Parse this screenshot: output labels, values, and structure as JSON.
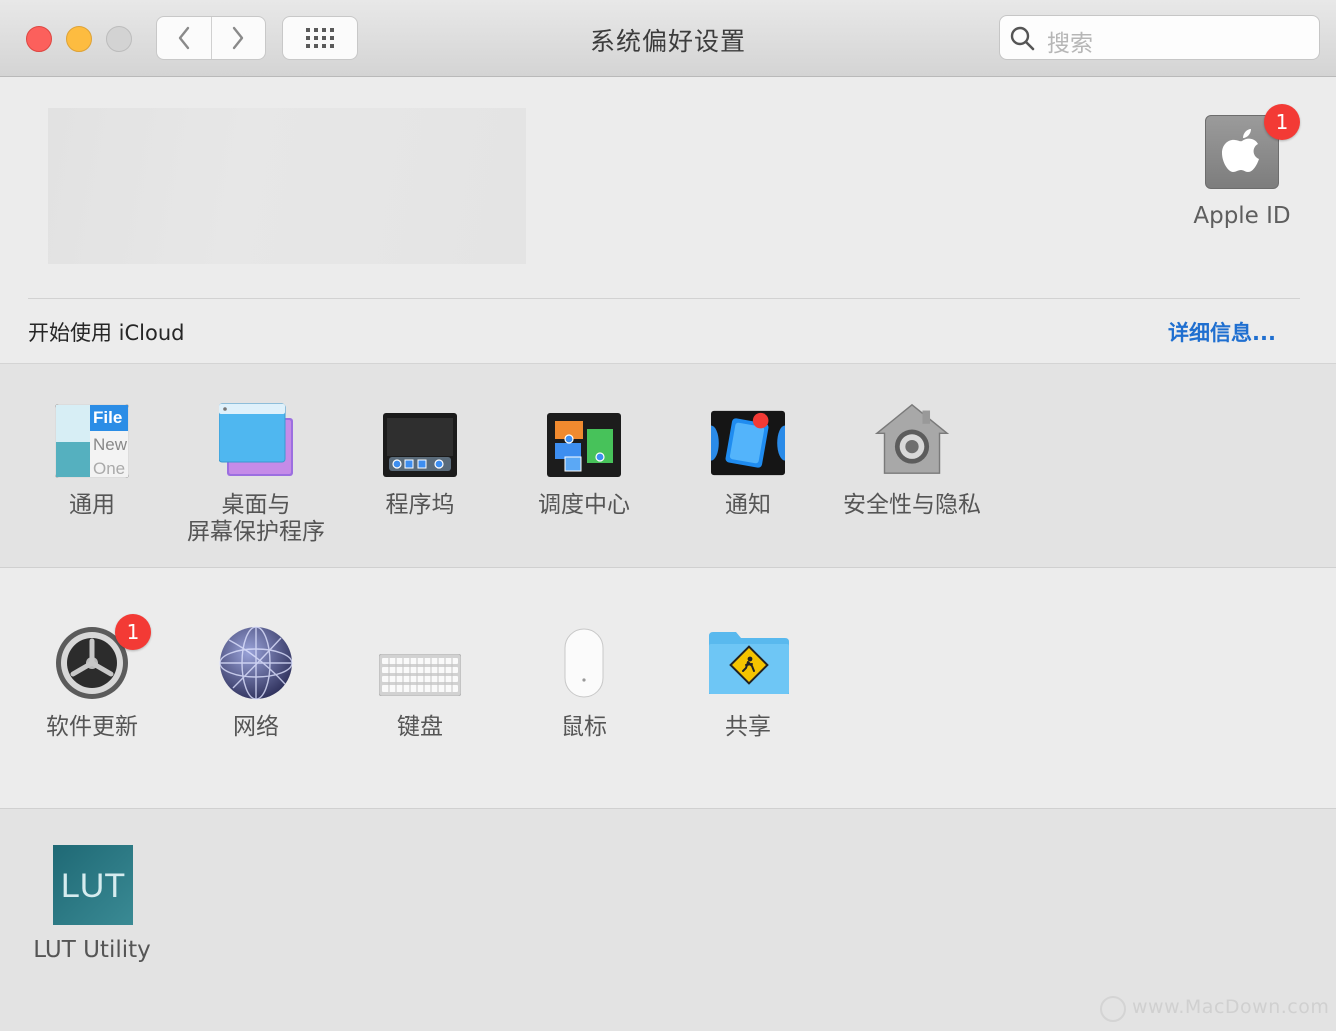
{
  "window": {
    "title": "系统偏好设置"
  },
  "toolbar": {
    "back_icon": "chevron-left-icon",
    "forward_icon": "chevron-right-icon",
    "show_all_icon": "grid-icon",
    "search_placeholder": "搜索"
  },
  "account": {
    "apple_id_label": "Apple ID",
    "apple_id_badge": "1",
    "icloud_prompt": "开始使用 iCloud",
    "details_link": "详细信息..."
  },
  "section1": [
    {
      "label": "通用"
    },
    {
      "label1": "桌面与",
      "label2": "屏幕保护程序"
    },
    {
      "label": "程序坞"
    },
    {
      "label": "调度中心"
    },
    {
      "label": "通知"
    },
    {
      "label": "安全性与隐私"
    }
  ],
  "section2": [
    {
      "label": "软件更新",
      "badge": "1"
    },
    {
      "label": "网络"
    },
    {
      "label": "键盘"
    },
    {
      "label": "鼠标"
    },
    {
      "label": "共享"
    }
  ],
  "section3": [
    {
      "label": "LUT Utility",
      "icon_text": "LUT"
    }
  ],
  "general_icon_text": {
    "line1": "File",
    "line2": "New",
    "line3": "One"
  },
  "watermark": "www.MacDown.com",
  "colors": {
    "accent_link": "#1f6fd0",
    "badge": "#f33a35"
  }
}
